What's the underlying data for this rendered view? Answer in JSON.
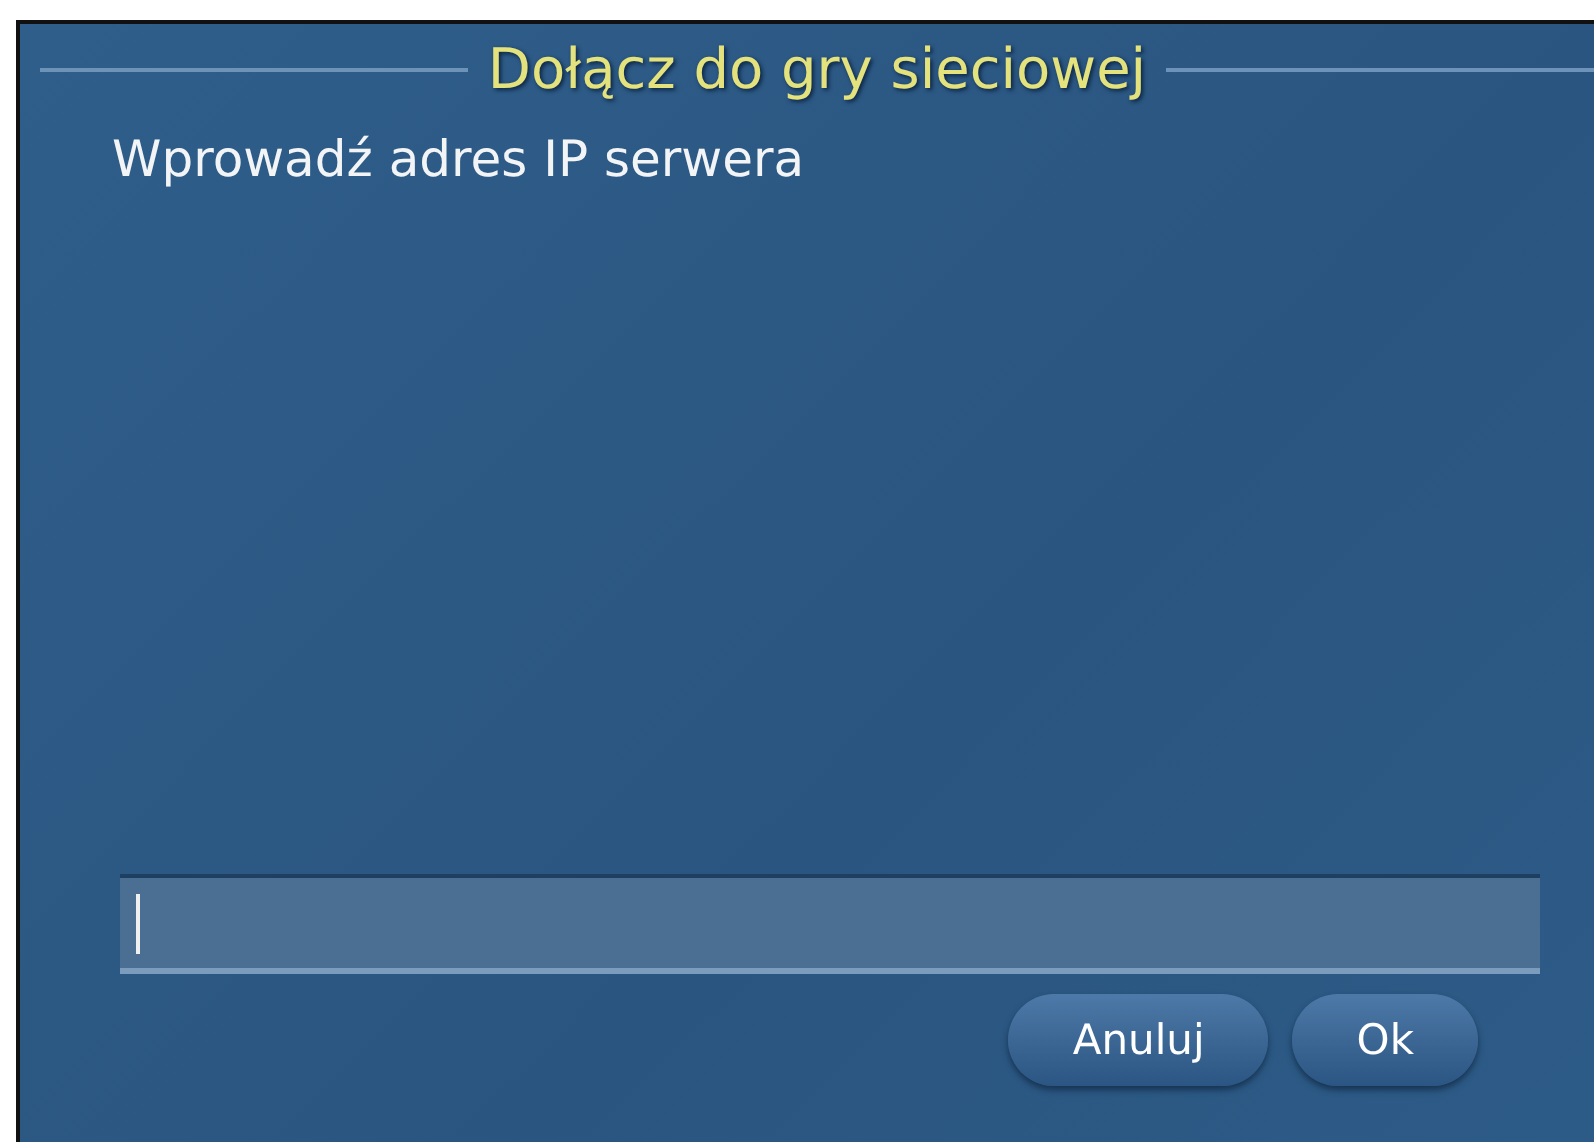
{
  "dialog": {
    "title": "Dołącz do gry sieciowej",
    "prompt": "Wprowadź adres IP serwera"
  },
  "ip_field": {
    "focused": true
  },
  "buttons": [
    {
      "label": "Anuluj"
    },
    {
      "label": "Ok"
    }
  ]
}
